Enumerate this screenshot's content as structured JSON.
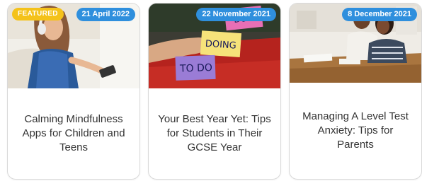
{
  "colors": {
    "date_badge_bg": "#2f8fdd",
    "featured_badge_bg": "#f4c21a",
    "title_text": "#333333",
    "card_border": "#d9d9d9"
  },
  "cards": [
    {
      "featured_label": "FEATURED",
      "date": "21 April 2022",
      "title": "Calming Mindfulness Apps for Children and Teens",
      "image": "girl-with-headphones-and-phone"
    },
    {
      "date": "22 November 2021",
      "title": "Your Best Year Yet: Tips for Students in Their GCSE Year",
      "image": "sticky-notes-to-do-doing-done"
    },
    {
      "date": "8 December 2021",
      "title": "Managing A Level Test Anxiety: Tips for Parents",
      "image": "parent-and-teen-at-table"
    }
  ]
}
